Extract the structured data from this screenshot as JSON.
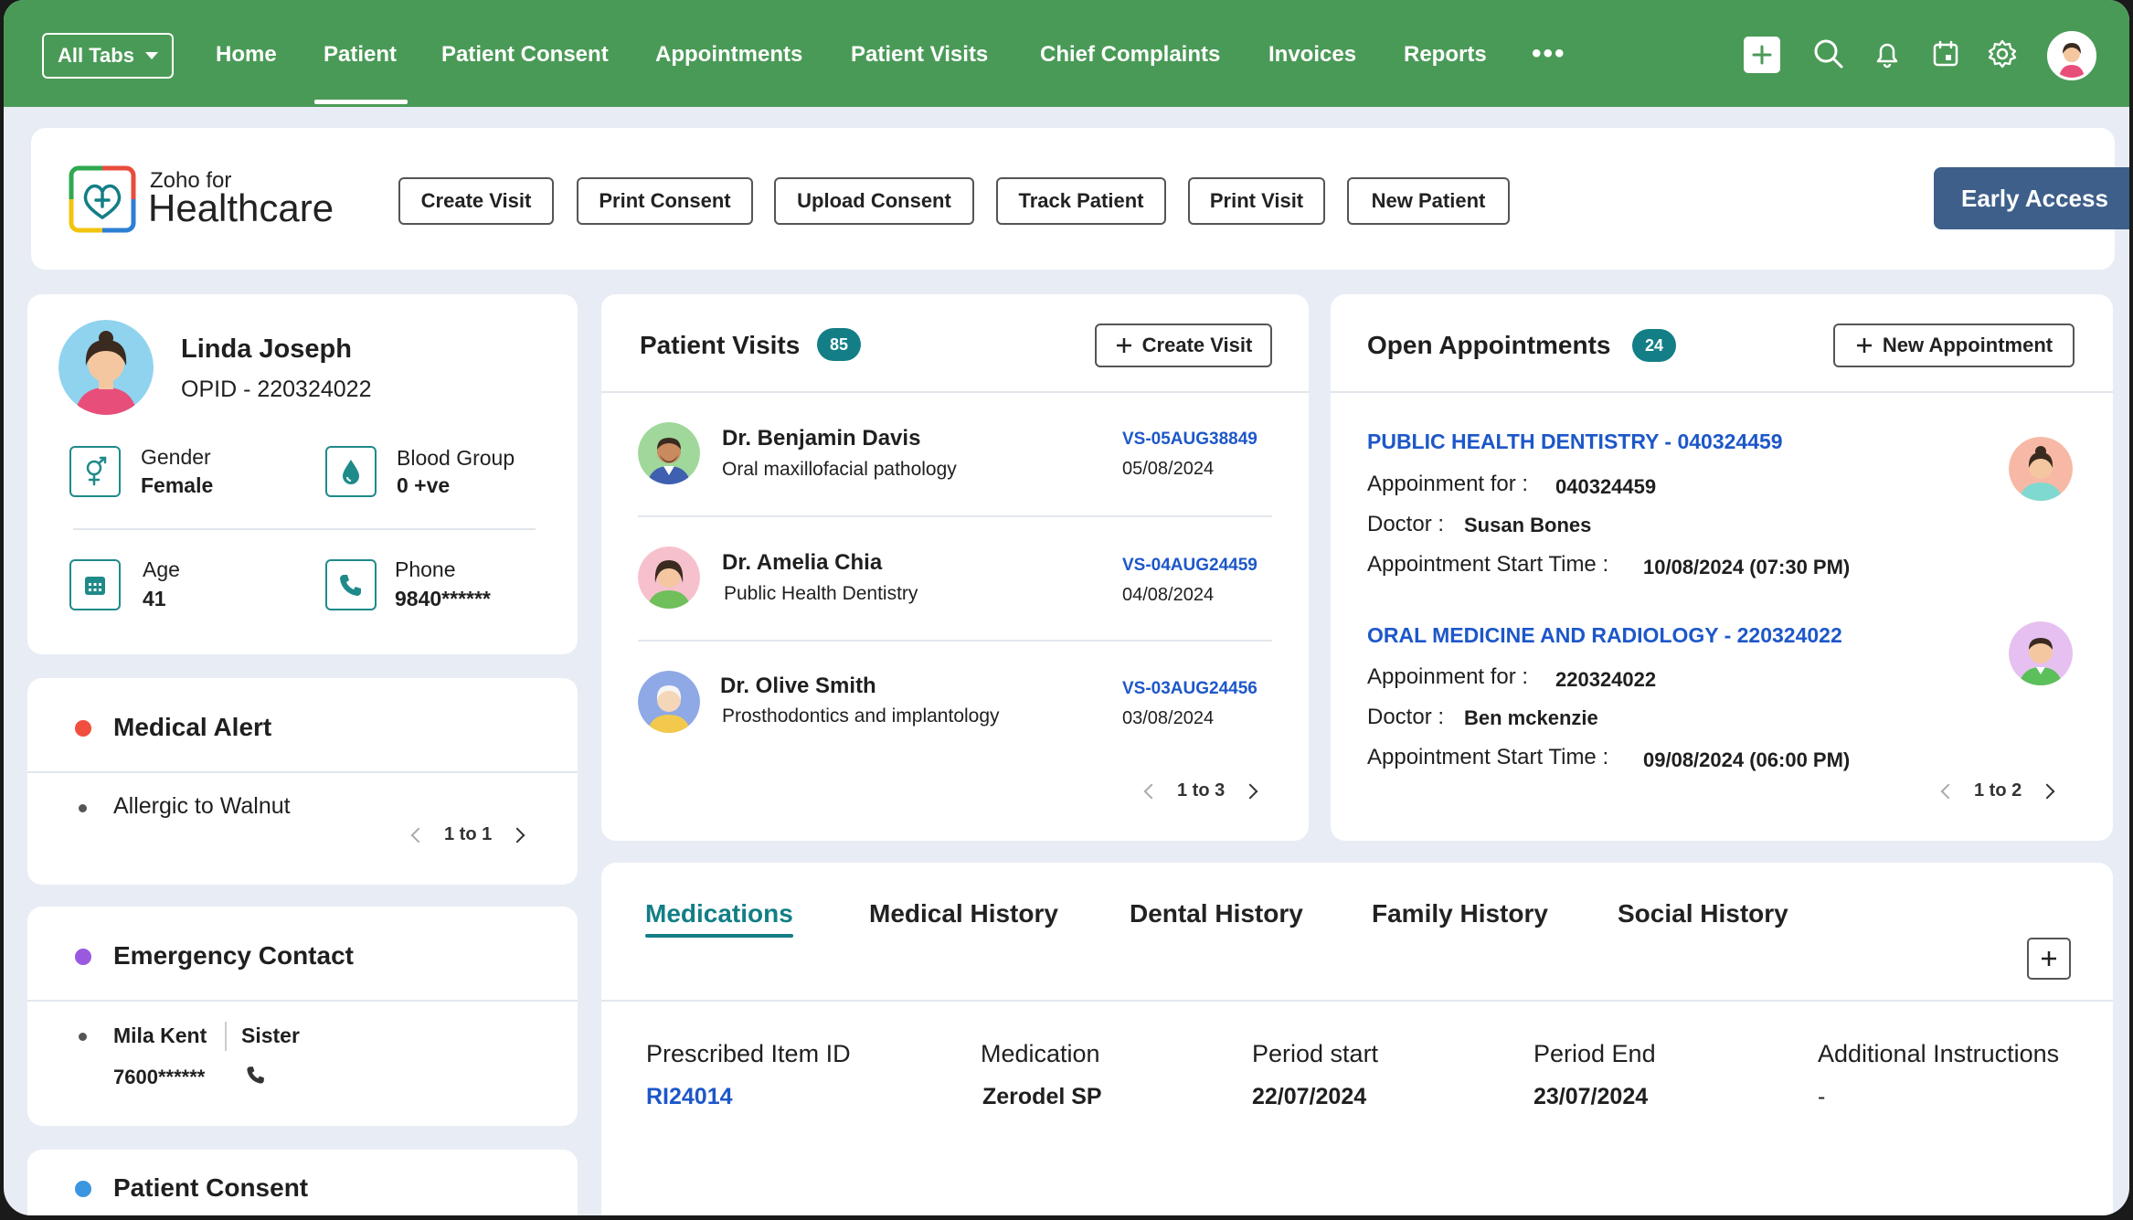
{
  "nav": {
    "all_tabs": "All Tabs",
    "items": [
      "Home",
      "Patient",
      "Patient Consent",
      "Appointments",
      "Patient Visits",
      "Chief Complaints",
      "Invoices",
      "Reports"
    ],
    "active": "Patient",
    "more": "•••",
    "icons": [
      "plus-icon",
      "search-icon",
      "bell-icon",
      "calendar-icon",
      "gear-icon",
      "user-avatar"
    ]
  },
  "header": {
    "logo_small": "Zoho for",
    "logo_big": "Healthcare",
    "buttons": [
      "Create Visit",
      "Print Consent",
      "Upload Consent",
      "Track Patient",
      "Print Visit",
      "New Patient"
    ],
    "early_access": "Early Access"
  },
  "patient": {
    "name": "Linda Joseph",
    "opid": "OPID - 220324022",
    "gender_label": "Gender",
    "gender": "Female",
    "blood_label": "Blood Group",
    "blood": "0 +ve",
    "age_label": "Age",
    "age": "41",
    "phone_label": "Phone",
    "phone": "9840******"
  },
  "medical_alert": {
    "title": "Medical Alert",
    "items": [
      "Allergic to Walnut"
    ],
    "pager": "1 to 1"
  },
  "emergency": {
    "title": "Emergency Contact",
    "name": "Mila Kent",
    "relation": "Sister",
    "phone": "7600******"
  },
  "consent": {
    "title": "Patient Consent"
  },
  "visits": {
    "title": "Patient Visits",
    "count": "85",
    "create_btn": "Create Visit",
    "items": [
      {
        "doctor": "Dr. Benjamin Davis",
        "specialty": "Oral maxillofacial pathology",
        "id": "VS-05AUG38849",
        "date": "05/08/2024"
      },
      {
        "doctor": "Dr. Amelia Chia",
        "specialty": "Public Health Dentistry",
        "id": "VS-04AUG24459",
        "date": "04/08/2024"
      },
      {
        "doctor": "Dr. Olive Smith",
        "specialty": "Prosthodontics and implantology",
        "id": "VS-03AUG24456",
        "date": "03/08/2024"
      }
    ],
    "pager": "1 to 3"
  },
  "appointments": {
    "title": "Open Appointments",
    "count": "24",
    "new_btn": "New Appointment",
    "for_label": "Appoinment for :",
    "doctor_label": "Doctor :",
    "start_label": "Appointment Start Time :",
    "items": [
      {
        "title": "PUBLIC HEALTH DENTISTRY - 040324459",
        "for": "040324459",
        "doctor": "Susan Bones",
        "start": "10/08/2024 (07:30 PM)"
      },
      {
        "title": "ORAL MEDICINE AND RADIOLOGY - 220324022",
        "for": "220324022",
        "doctor": "Ben mckenzie",
        "start": "09/08/2024 (06:00 PM)"
      }
    ],
    "pager": "1 to 2"
  },
  "history": {
    "tabs": [
      "Medications",
      "Medical History",
      "Dental History",
      "Family History",
      "Social History"
    ],
    "active": "Medications",
    "columns": [
      "Prescribed Item ID",
      "Medication",
      "Period start",
      "Period End",
      "Additional Instructions"
    ],
    "rows": [
      [
        "RI24014",
        "Zerodel SP",
        "22/07/2024",
        "23/07/2024",
        "-"
      ]
    ]
  },
  "colors": {
    "nav_green": "#4a9a57",
    "teal": "#137e86",
    "link_blue": "#1d57c9",
    "early_access": "#3e5f8a"
  }
}
